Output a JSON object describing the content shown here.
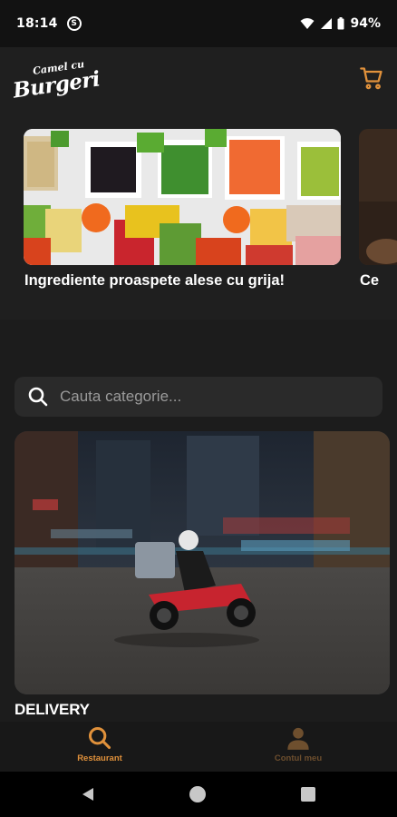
{
  "status_bar": {
    "time": "18:14",
    "carrier_badge": "S",
    "battery": "94%"
  },
  "header": {
    "logo_small": "Camel cu",
    "logo_big": "Burgeri",
    "cart_icon": "cart-icon"
  },
  "carousel": {
    "slides": [
      {
        "caption": "Ingrediente proaspete alese cu grija!"
      },
      {
        "caption": "Ce"
      }
    ]
  },
  "search": {
    "placeholder": "Cauta categorie...",
    "value": ""
  },
  "categories": [
    {
      "title": "DELIVERY"
    }
  ],
  "bottom_nav": {
    "items": [
      {
        "label": "Restaurant",
        "icon": "search-icon",
        "active": true
      },
      {
        "label": "Contul meu",
        "icon": "user-icon",
        "active": false
      }
    ]
  },
  "colors": {
    "accent": "#e0913b",
    "background": "#1c1c1c",
    "surface": "#2a2a2a"
  }
}
